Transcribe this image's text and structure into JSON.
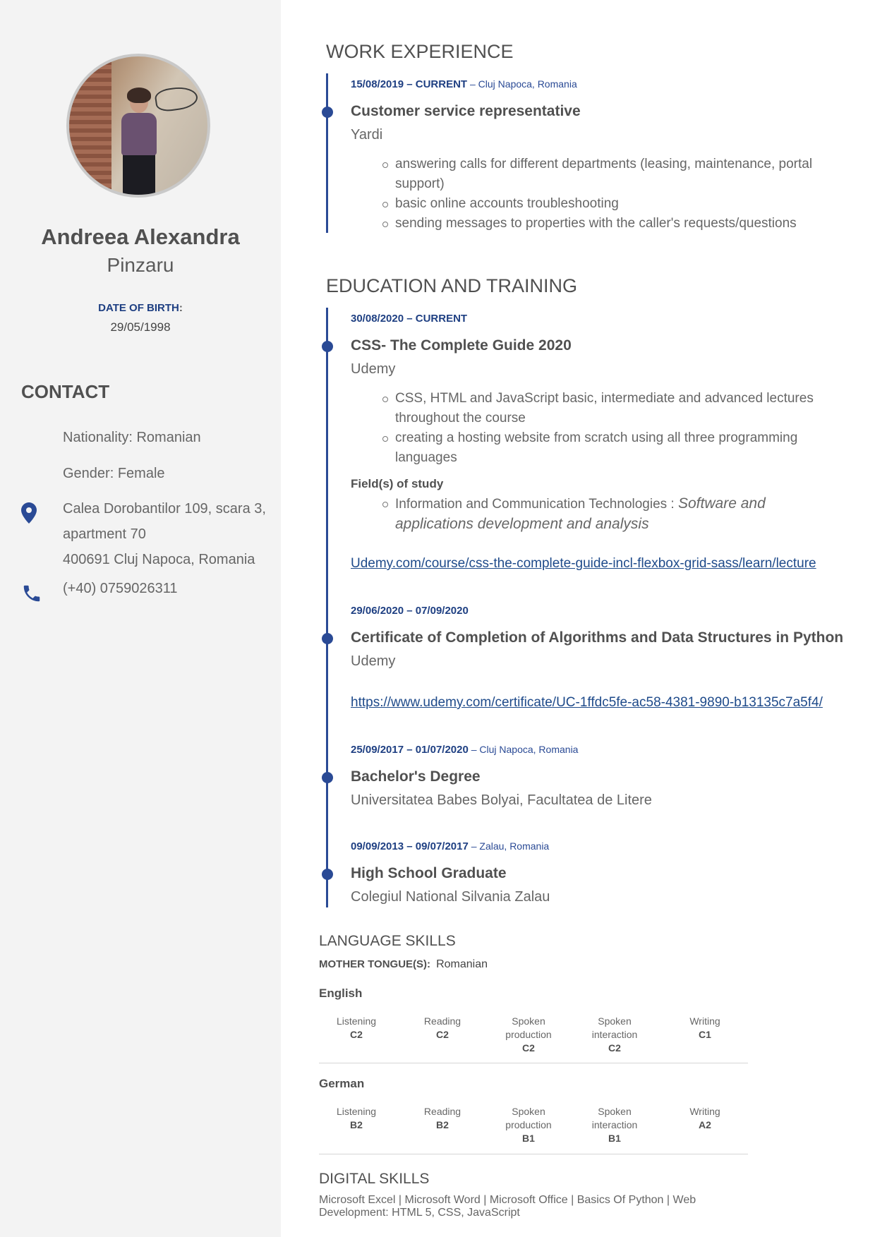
{
  "sidebar": {
    "first_name": "Andreea Alexandra",
    "last_name": "Pinzaru",
    "dob_label": "DATE OF BIRTH",
    "dob_colon": ":",
    "dob_value": "29/05/1998",
    "contact_title": "CONTACT",
    "nationality": "Nationality: Romanian",
    "gender": "Gender: Female",
    "address_line1": "Calea Dorobantilor 109, scara 3,",
    "address_line2": "apartment 70",
    "address_line3": "400691 Cluj Napoca, Romania",
    "phone": "(+40) 0759026311",
    "icons": {
      "location": "location-pin-icon",
      "phone": "phone-icon"
    },
    "accent_color": "#2a4a95"
  },
  "work": {
    "title": "WORK EXPERIENCE",
    "items": [
      {
        "date": "15/08/2019 – CURRENT",
        "place": " – Cluj Napoca, Romania",
        "role": "Customer service representative",
        "org": "Yardi",
        "bullets": [
          "answering calls for different departments (leasing, maintenance, portal support)",
          "basic online accounts troubleshooting",
          "sending messages to properties with the caller's requests/questions"
        ]
      }
    ]
  },
  "education": {
    "title": "EDUCATION AND TRAINING",
    "items": [
      {
        "date": "30/08/2020 – CURRENT",
        "role": "CSS- The Complete Guide 2020",
        "org": "Udemy",
        "bullets": [
          "CSS, HTML and JavaScript basic, intermediate and advanced lectures throughout the course",
          "creating a hosting website from scratch using all three programming languages"
        ],
        "field_label": "Field(s) of study",
        "field_text": "Information and Communication Technologies : ",
        "field_italic": "Software and applications development and analysis",
        "link": "Udemy.com/course/css-the-complete-guide-incl-flexbox-grid-sass/learn/lecture"
      },
      {
        "date": "29/06/2020 – 07/09/2020",
        "role": "Certificate of Completion of Algorithms and Data Structures in Python",
        "org": "Udemy",
        "link": "https://www.udemy.com/certificate/UC-1ffdc5fe-ac58-4381-9890-b13135c7a5f4/"
      },
      {
        "date": "25/09/2017 – 01/07/2020",
        "place": " – Cluj Napoca, Romania",
        "role": "Bachelor's Degree",
        "org": "Universitatea Babes Bolyai, Facultatea de Litere"
      },
      {
        "date": "09/09/2013 – 09/07/2017",
        "place": " – Zalau, Romania",
        "role": "High School Graduate",
        "org": "Colegiul National Silvania Zalau"
      }
    ]
  },
  "languages": {
    "title": "LANGUAGE SKILLS",
    "mother_label": "MOTHER TONGUE(S):",
    "mother_value": "Romanian",
    "items": [
      {
        "name": "English",
        "skills": [
          {
            "label1": "Listening",
            "label2": "",
            "level": "C2"
          },
          {
            "label1": "Reading",
            "label2": "",
            "level": "C2"
          },
          {
            "label1": "Spoken",
            "label2": "production",
            "level": "C2"
          },
          {
            "label1": "Spoken",
            "label2": "interaction",
            "level": "C2"
          },
          {
            "label1": "Writing",
            "label2": "",
            "level": "C1"
          }
        ]
      },
      {
        "name": "German",
        "skills": [
          {
            "label1": "Listening",
            "label2": "",
            "level": "B2"
          },
          {
            "label1": "Reading",
            "label2": "",
            "level": "B2"
          },
          {
            "label1": "Spoken",
            "label2": "production",
            "level": "B1"
          },
          {
            "label1": "Spoken",
            "label2": "interaction",
            "level": "B1"
          },
          {
            "label1": "Writing",
            "label2": "",
            "level": "A2"
          }
        ]
      }
    ]
  },
  "digital": {
    "title": "DIGITAL SKILLS",
    "text": "Microsoft Excel | Microsoft Word | Microsoft Office | Basics Of Python | Web Development: HTML 5, CSS, JavaScript"
  }
}
